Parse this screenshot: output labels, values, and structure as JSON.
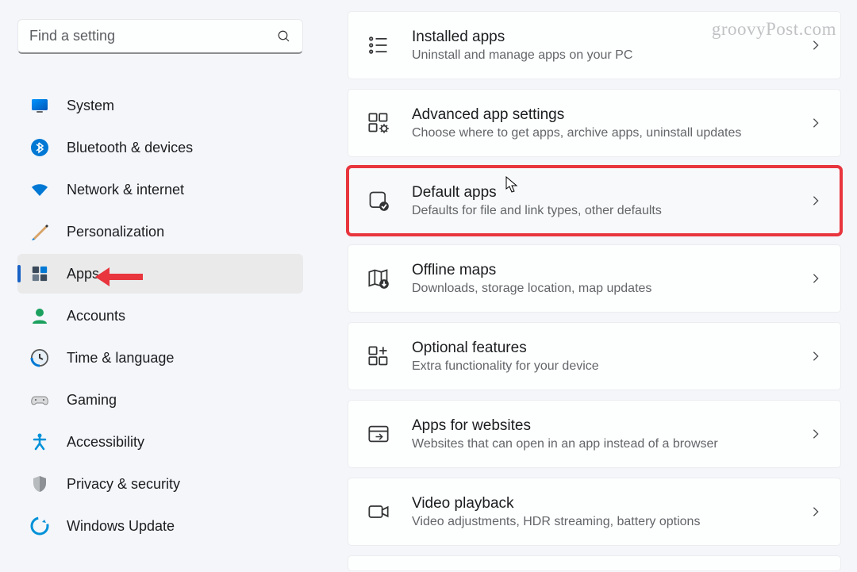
{
  "search": {
    "placeholder": "Find a setting"
  },
  "sidebar": {
    "items": [
      {
        "label": "System"
      },
      {
        "label": "Bluetooth & devices"
      },
      {
        "label": "Network & internet"
      },
      {
        "label": "Personalization"
      },
      {
        "label": "Apps"
      },
      {
        "label": "Accounts"
      },
      {
        "label": "Time & language"
      },
      {
        "label": "Gaming"
      },
      {
        "label": "Accessibility"
      },
      {
        "label": "Privacy & security"
      },
      {
        "label": "Windows Update"
      }
    ]
  },
  "main": {
    "cards": [
      {
        "title": "Installed apps",
        "sub": "Uninstall and manage apps on your PC"
      },
      {
        "title": "Advanced app settings",
        "sub": "Choose where to get apps, archive apps, uninstall updates"
      },
      {
        "title": "Default apps",
        "sub": "Defaults for file and link types, other defaults"
      },
      {
        "title": "Offline maps",
        "sub": "Downloads, storage location, map updates"
      },
      {
        "title": "Optional features",
        "sub": "Extra functionality for your device"
      },
      {
        "title": "Apps for websites",
        "sub": "Websites that can open in an app instead of a browser"
      },
      {
        "title": "Video playback",
        "sub": "Video adjustments, HDR streaming, battery options"
      }
    ]
  },
  "watermark": "groovyPost.com"
}
